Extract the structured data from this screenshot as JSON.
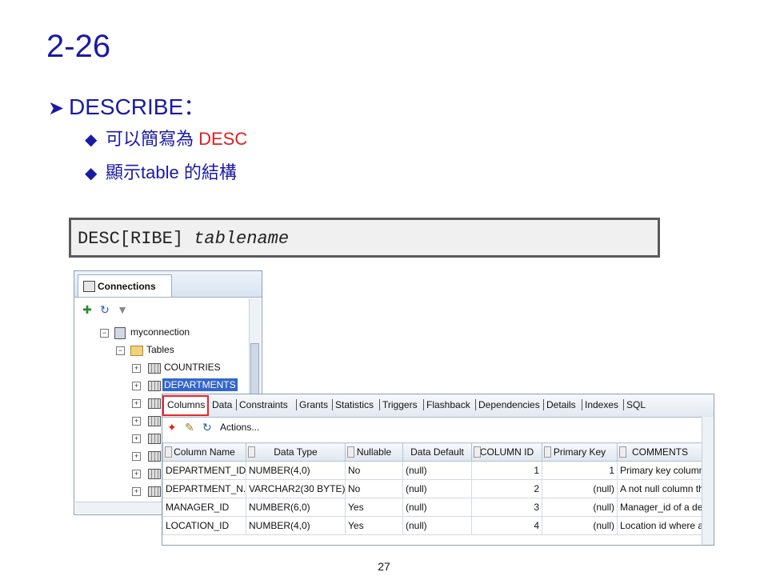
{
  "slide": {
    "title": "2-26",
    "bullet_main": "DESCRIBE：",
    "sub_bullets": [
      {
        "prefix": "可以簡寫為 ",
        "highlight": "DESC"
      },
      {
        "prefix": "顯示table 的結構",
        "highlight": ""
      }
    ],
    "page_number": "27"
  },
  "syntax": {
    "keyword": "DESC[RIBE]",
    "argument": "tablename"
  },
  "connections_panel": {
    "tab_label": "Connections",
    "tree": {
      "connection": "myconnection",
      "folder": "Tables",
      "tables": [
        "COUNTRIES",
        "DEPARTMENTS"
      ],
      "selected_table": "DEPARTMENTS"
    }
  },
  "columns_panel": {
    "tabs": [
      "Columns",
      "Data",
      "Constraints",
      "Grants",
      "Statistics",
      "Triggers",
      "Flashback",
      "Dependencies",
      "Details",
      "Indexes",
      "SQL"
    ],
    "active_tab": "Columns",
    "actions_label": "Actions...",
    "headers": [
      "Column Name",
      "Data Type",
      "Nullable",
      "Data Default",
      "COLUMN ID",
      "Primary Key",
      "COMMENTS"
    ],
    "rows": [
      [
        "DEPARTMENT_ID",
        "NUMBER(4,0)",
        "No",
        "(null)",
        "1",
        "1",
        "Primary key column"
      ],
      [
        "DEPARTMENT_N...",
        "VARCHAR2(30 BYTE)",
        "No",
        "(null)",
        "2",
        "(null)",
        "A not null column th"
      ],
      [
        "MANAGER_ID",
        "NUMBER(6,0)",
        "Yes",
        "(null)",
        "3",
        "(null)",
        "Manager_id of a dep"
      ],
      [
        "LOCATION_ID",
        "NUMBER(4,0)",
        "Yes",
        "(null)",
        "4",
        "(null)",
        "Location id where a"
      ]
    ]
  },
  "colors": {
    "title_blue": "#1a1aa6",
    "highlight_red": "#e02020",
    "selection_blue": "#3366cc",
    "tab_outline_red": "#e8262b"
  }
}
